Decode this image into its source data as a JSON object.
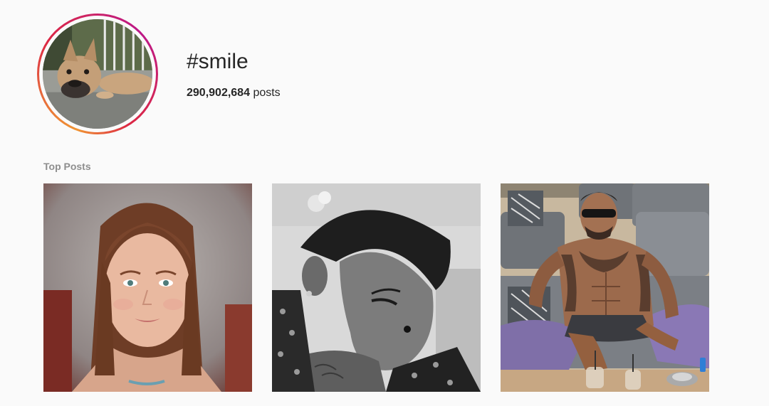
{
  "hashtag": {
    "title": "#smile",
    "post_count": "290,902,684",
    "post_count_suffix": "posts"
  },
  "top_posts": {
    "section_label": "Top Posts",
    "items": [
      {
        "subject": "girl-portrait-photo"
      },
      {
        "subject": "bw-woman-portrait-photo"
      },
      {
        "subject": "tattooed-man-lounge-photo"
      }
    ]
  },
  "colors": {
    "background": "#fafafa",
    "text_primary": "#262626",
    "text_secondary": "#8e8e8e",
    "story_ring_start": "#f09433",
    "story_ring_end": "#bc1888"
  }
}
